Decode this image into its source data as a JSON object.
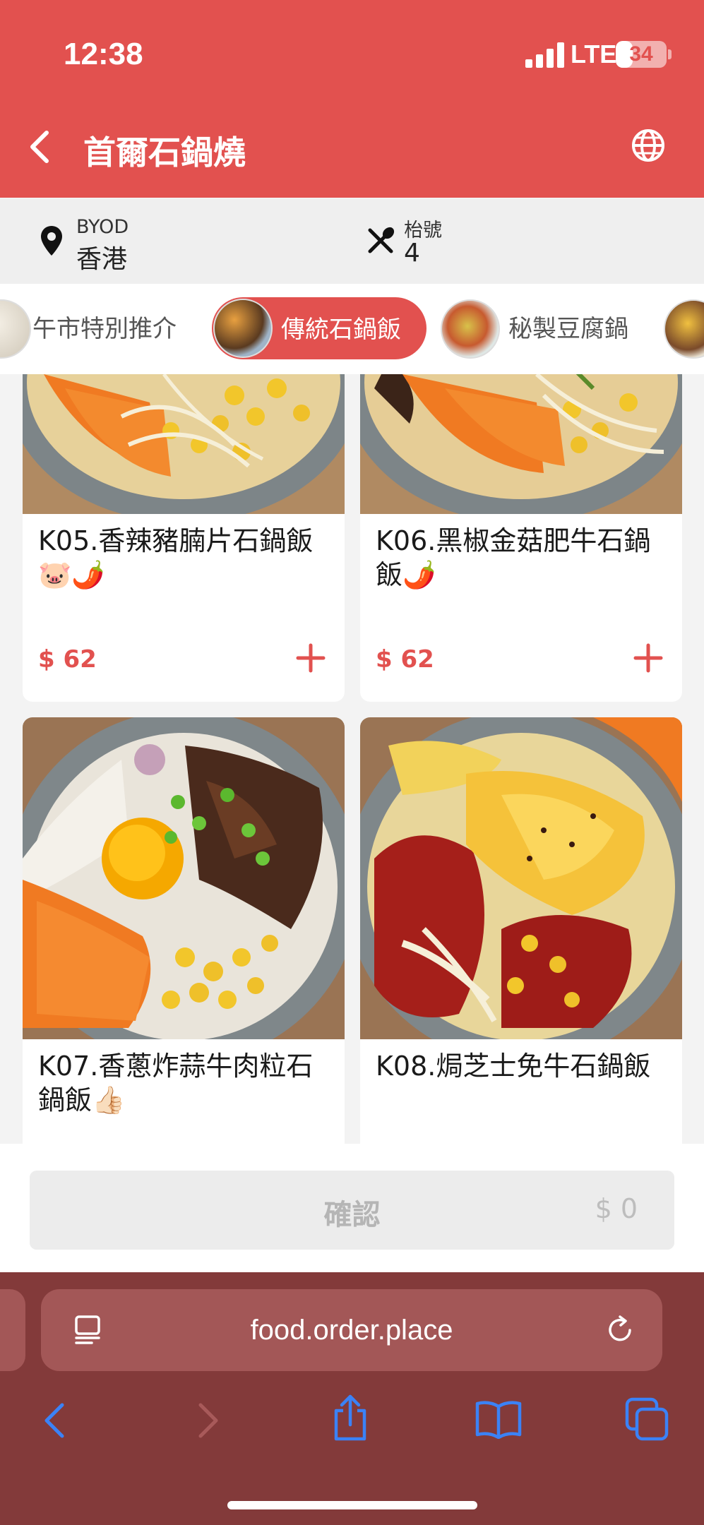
{
  "status_bar": {
    "time": "12:38",
    "network": "LTE",
    "battery": "34",
    "battery_level": 0.34
  },
  "header": {
    "title": "首爾石鍋燒"
  },
  "info": {
    "location_label": "BYOD",
    "location_value": "香港",
    "table_label": "枱號",
    "table_value": "4"
  },
  "categories": [
    {
      "label": "午市特別推介",
      "active": false
    },
    {
      "label": "傳統石鍋飯",
      "active": true
    },
    {
      "label": "秘製豆腐鍋",
      "active": false
    }
  ],
  "items": [
    {
      "name": "K05.香辣豬腩片石鍋飯🐷🌶️",
      "price": "$ 62"
    },
    {
      "name": "K06.黑椒金菇肥牛石鍋飯🌶️",
      "price": "$ 62"
    },
    {
      "name": "K07.香蔥炸蒜牛肉粒石鍋飯👍🏻",
      "price": ""
    },
    {
      "name": "K08.焗芝士免牛石鍋飯",
      "price": ""
    }
  ],
  "confirm": {
    "label": "確認",
    "amount": "$ 0"
  },
  "browser": {
    "url": "food.order.place"
  },
  "colors": {
    "brand": "#e2514f",
    "safari_bar": "#833a3a",
    "ios_blue": "#3b82f6"
  },
  "icons": [
    "back-icon",
    "globe-icon",
    "pin-icon",
    "utensils-icon",
    "plus-icon",
    "reader-icon",
    "reload-icon",
    "share-icon",
    "bookmarks-icon",
    "tabs-icon"
  ]
}
